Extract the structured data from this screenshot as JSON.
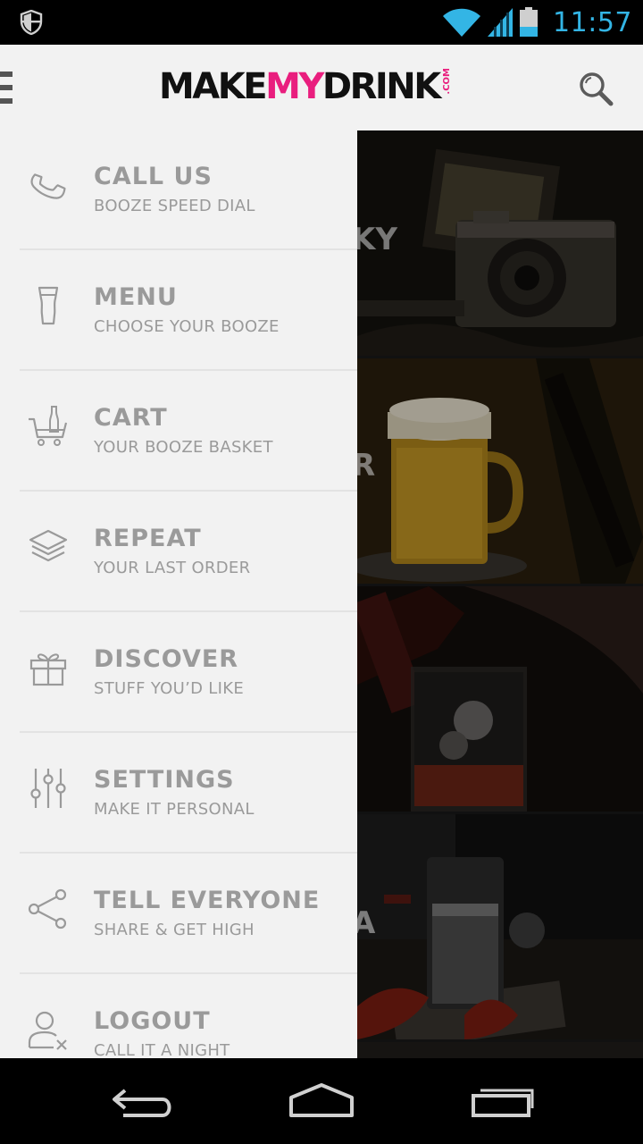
{
  "status_bar": {
    "time": "11:57",
    "icons": [
      "shield-icon",
      "wifi-icon",
      "signal-icon",
      "battery-icon"
    ],
    "accent_color": "#33b5e5"
  },
  "header": {
    "logo_part1": "MAKE",
    "logo_part2": "MY",
    "logo_part3": "DRINK",
    "logo_suffix": ".COM",
    "brand_color": "#e91e7e",
    "icons": [
      "menu-icon",
      "search-icon"
    ]
  },
  "drawer": {
    "items": [
      {
        "title": "CALL US",
        "subtitle": "BOOZE SPEED DIAL",
        "icon": "phone-icon"
      },
      {
        "title": "MENU",
        "subtitle": "CHOOSE YOUR BOOZE",
        "icon": "pint-glass-icon"
      },
      {
        "title": "CART",
        "subtitle": "YOUR BOOZE BASKET",
        "icon": "cart-icon"
      },
      {
        "title": "REPEAT",
        "subtitle": "YOUR LAST ORDER",
        "icon": "layers-icon"
      },
      {
        "title": "DISCOVER",
        "subtitle": "STUFF YOU’D LIKE",
        "icon": "gift-icon"
      },
      {
        "title": "SETTINGS",
        "subtitle": "MAKE IT PERSONAL",
        "icon": "sliders-icon"
      },
      {
        "title": "TELL EVERYONE",
        "subtitle": "SHARE & GET HIGH",
        "icon": "share-icon"
      },
      {
        "title": "LOGOUT",
        "subtitle": "CALL IT A NIGHT",
        "icon": "user-logout-icon"
      }
    ]
  },
  "content": {
    "tiles": [
      {
        "label": "KY",
        "image": "whisky-camera-photo"
      },
      {
        "label": "R",
        "image": "beer-mug-photo"
      },
      {
        "label": "",
        "image": "cocktail-glass-photo"
      },
      {
        "label": "A",
        "image": "vodka-shot-photo"
      }
    ]
  },
  "nav_bar": {
    "icons": [
      "back-icon",
      "home-icon",
      "recents-icon"
    ]
  }
}
